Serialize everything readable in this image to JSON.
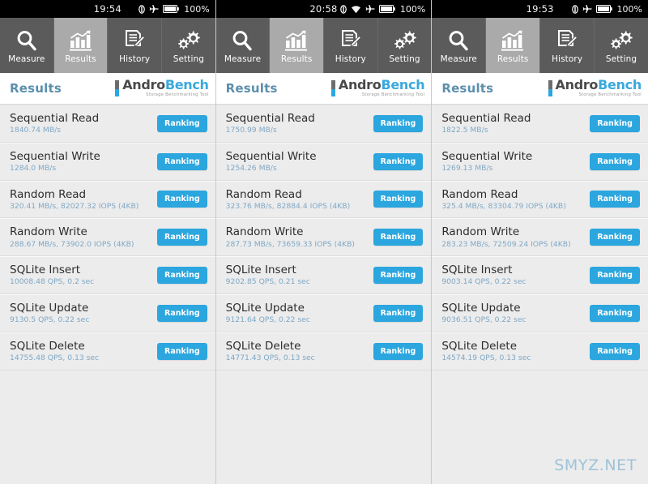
{
  "app": {
    "name": "AndroBench",
    "logo_andro": "Andro",
    "logo_bench": "Bench",
    "logo_tagline": "Storage Benchmarking Tool",
    "header_title": "Results",
    "accent_color": "#2ba6de",
    "value_color": "#7fa8c4",
    "tabbar_bg": "#5b5b5b",
    "tab_active_bg": "#aaaaaa",
    "watermark": "SMYZ.NET"
  },
  "tabs": [
    {
      "label": "Measure",
      "icon": "magnifier-icon",
      "active": false
    },
    {
      "label": "Results",
      "icon": "bar-chart-icon",
      "active": true
    },
    {
      "label": "History",
      "icon": "document-pencil-icon",
      "active": false
    },
    {
      "label": "Setting",
      "icon": "gears-icon",
      "active": false
    }
  ],
  "ranking_label": "Ranking",
  "panels": [
    {
      "status": {
        "time": "19:54",
        "battery_percent": "100%",
        "icons": [
          "sim-icon",
          "airplane-icon",
          "battery-icon"
        ]
      },
      "rows": [
        {
          "title": "Sequential Read",
          "value": "1840.74 MB/s"
        },
        {
          "title": "Sequential Write",
          "value": "1284.0 MB/s"
        },
        {
          "title": "Random Read",
          "value": "320.41 MB/s, 82027.32 IOPS (4KB)"
        },
        {
          "title": "Random Write",
          "value": "288.67 MB/s, 73902.0 IOPS (4KB)"
        },
        {
          "title": "SQLite Insert",
          "value": "10008.48 QPS, 0.2 sec"
        },
        {
          "title": "SQLite Update",
          "value": "9130.5 QPS, 0.22 sec"
        },
        {
          "title": "SQLite Delete",
          "value": "14755.48 QPS, 0.13 sec"
        }
      ]
    },
    {
      "status": {
        "time": "20:58",
        "battery_percent": "100%",
        "icons": [
          "sim-icon",
          "wifi-icon",
          "airplane-icon",
          "battery-icon"
        ]
      },
      "rows": [
        {
          "title": "Sequential Read",
          "value": "1750.99 MB/s"
        },
        {
          "title": "Sequential Write",
          "value": "1254.26 MB/s"
        },
        {
          "title": "Random Read",
          "value": "323.76 MB/s, 82884.4 IOPS (4KB)"
        },
        {
          "title": "Random Write",
          "value": "287.73 MB/s, 73659.33 IOPS (4KB)"
        },
        {
          "title": "SQLite Insert",
          "value": "9202.85 QPS, 0.21 sec"
        },
        {
          "title": "SQLite Update",
          "value": "9121.64 QPS, 0.22 sec"
        },
        {
          "title": "SQLite Delete",
          "value": "14771.43 QPS, 0.13 sec"
        }
      ]
    },
    {
      "status": {
        "time": "19:53",
        "battery_percent": "100%",
        "icons": [
          "sim-icon",
          "airplane-icon",
          "battery-icon"
        ]
      },
      "rows": [
        {
          "title": "Sequential Read",
          "value": "1822.5 MB/s"
        },
        {
          "title": "Sequential Write",
          "value": "1269.13 MB/s"
        },
        {
          "title": "Random Read",
          "value": "325.4 MB/s, 83304.79 IOPS (4KB)"
        },
        {
          "title": "Random Write",
          "value": "283.23 MB/s, 72509.24 IOPS (4KB)"
        },
        {
          "title": "SQLite Insert",
          "value": "9003.14 QPS, 0.22 sec"
        },
        {
          "title": "SQLite Update",
          "value": "9036.51 QPS, 0.22 sec"
        },
        {
          "title": "SQLite Delete",
          "value": "14574.19 QPS, 0.13 sec"
        }
      ]
    }
  ]
}
